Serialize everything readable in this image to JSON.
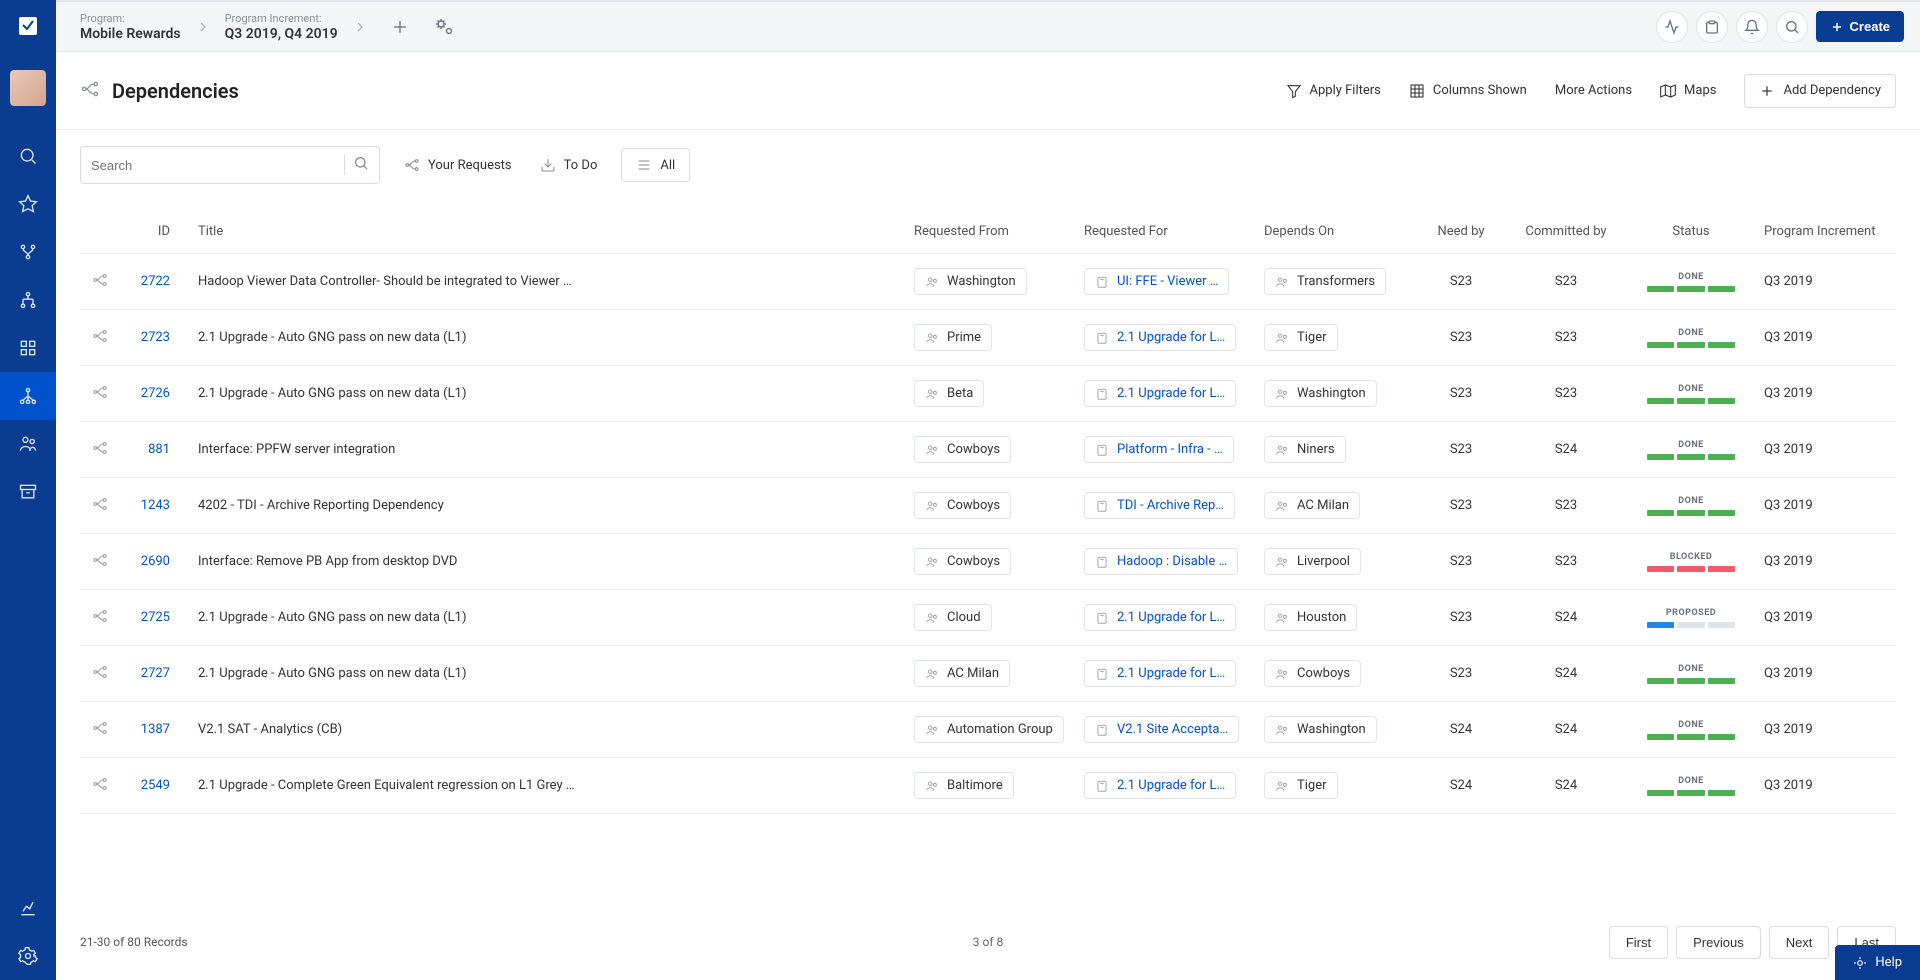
{
  "breadcrumbs": {
    "program_label": "Program:",
    "program_value": "Mobile Rewards",
    "increment_label": "Program Increment:",
    "increment_value": "Q3 2019, Q4 2019"
  },
  "top_buttons": {
    "create": "Create"
  },
  "page": {
    "title": "Dependencies"
  },
  "header_actions": {
    "apply_filters": "Apply Filters",
    "columns_shown": "Columns Shown",
    "more_actions": "More Actions",
    "maps": "Maps",
    "add_dependency": "Add Dependency"
  },
  "toolbar": {
    "search_placeholder": "Search",
    "your_requests": "Your Requests",
    "to_do": "To Do",
    "all": "All"
  },
  "columns": {
    "id": "ID",
    "title": "Title",
    "requested_from": "Requested From",
    "requested_for": "Requested For",
    "depends_on": "Depends On",
    "need_by": "Need by",
    "committed_by": "Committed by",
    "status": "Status",
    "pi": "Program Increment"
  },
  "status_labels": {
    "done": "DONE",
    "blocked": "BLOCKED",
    "proposed": "PROPOSED"
  },
  "status_colors": {
    "done": "#4caf50",
    "blocked": "#f05a6a",
    "proposed_active": "#1e88e5",
    "inactive": "#e1e4e8"
  },
  "rows": [
    {
      "id": "2722",
      "title": "Hadoop Viewer Data Controller- Should be integrated to Viewer …",
      "requested_from": "Washington",
      "requested_for": "UI: FFE - Viewer …",
      "depends_on": "Transformers",
      "need_by": "S23",
      "committed_by": "S23",
      "status": "done",
      "pi": "Q3 2019"
    },
    {
      "id": "2723",
      "title": "2.1 Upgrade - Auto GNG pass on new data (L1)",
      "requested_from": "Prime",
      "requested_for": "2.1 Upgrade for L…",
      "depends_on": "Tiger",
      "need_by": "S23",
      "committed_by": "S23",
      "status": "done",
      "pi": "Q3 2019"
    },
    {
      "id": "2726",
      "title": "2.1 Upgrade - Auto GNG pass on new data (L1)",
      "requested_from": "Beta",
      "requested_for": "2.1 Upgrade for L…",
      "depends_on": "Washington",
      "need_by": "S23",
      "committed_by": "S23",
      "status": "done",
      "pi": "Q3 2019"
    },
    {
      "id": "881",
      "title": "Interface: PPFW server integration",
      "requested_from": "Cowboys",
      "requested_for": "Platform - Infra - …",
      "depends_on": "Niners",
      "need_by": "S23",
      "committed_by": "S24",
      "status": "done",
      "pi": "Q3 2019"
    },
    {
      "id": "1243",
      "title": "4202 - TDI - Archive Reporting Dependency",
      "requested_from": "Cowboys",
      "requested_for": "TDI - Archive Rep…",
      "depends_on": "AC Milan",
      "need_by": "S23",
      "committed_by": "S23",
      "status": "done",
      "pi": "Q3 2019"
    },
    {
      "id": "2690",
      "title": "Interface: Remove PB App from desktop DVD",
      "requested_from": "Cowboys",
      "requested_for": "Hadoop : Disable …",
      "depends_on": "Liverpool",
      "need_by": "S23",
      "committed_by": "S23",
      "status": "blocked",
      "pi": "Q3 2019"
    },
    {
      "id": "2725",
      "title": "2.1 Upgrade - Auto GNG pass on new data (L1)",
      "requested_from": "Cloud",
      "requested_for": "2.1 Upgrade for L…",
      "depends_on": "Houston",
      "need_by": "S23",
      "committed_by": "S24",
      "status": "proposed",
      "pi": "Q3 2019"
    },
    {
      "id": "2727",
      "title": "2.1 Upgrade - Auto GNG pass on new data (L1)",
      "requested_from": "AC Milan",
      "requested_for": "2.1 Upgrade for L…",
      "depends_on": "Cowboys",
      "need_by": "S23",
      "committed_by": "S24",
      "status": "done",
      "pi": "Q3 2019"
    },
    {
      "id": "1387",
      "title": "V2.1 SAT - Analytics (CB)",
      "requested_from": "Automation Group",
      "requested_for": "V2.1 Site Accepta…",
      "depends_on": "Washington",
      "need_by": "S24",
      "committed_by": "S24",
      "status": "done",
      "pi": "Q3 2019"
    },
    {
      "id": "2549",
      "title": "2.1 Upgrade - Complete Green Equivalent regression on L1 Grey …",
      "requested_from": "Baltimore",
      "requested_for": "2.1 Upgrade for L…",
      "depends_on": "Tiger",
      "need_by": "S24",
      "committed_by": "S24",
      "status": "done",
      "pi": "Q3 2019"
    }
  ],
  "footer": {
    "records": "21-30 of 80 Records",
    "page_of": "3 of 8",
    "first": "First",
    "previous": "Previous",
    "next": "Next",
    "last": "Last"
  },
  "help": {
    "label": "Help"
  }
}
